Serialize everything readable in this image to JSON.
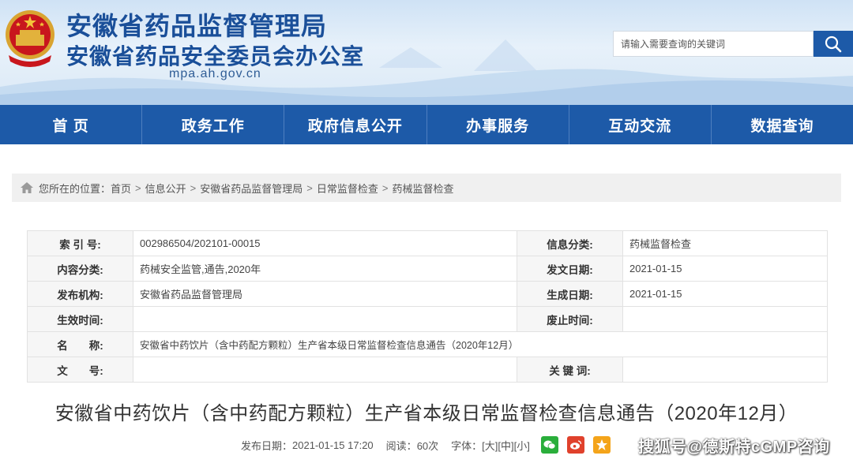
{
  "header": {
    "title_line1": "安徽省药品监督管理局",
    "title_line2": "安徽省药品安全委员会办公室",
    "url": "mpa.ah.gov.cn",
    "emblem": "national-emblem",
    "colors": {
      "title": "#1a4f99",
      "nav_bg": "#1d5aa8"
    }
  },
  "search": {
    "placeholder": "请输入需要查询的关键词",
    "icon": "search-icon"
  },
  "nav": {
    "items": [
      "首 页",
      "政务工作",
      "政府信息公开",
      "办事服务",
      "互动交流",
      "数据查询"
    ]
  },
  "breadcrumb": {
    "prefix": "您所在的位置：",
    "items": [
      "首页",
      "信息公开",
      "安徽省药品监督管理局",
      "日常监督检查",
      "药械监督检查"
    ],
    "separator": ">"
  },
  "info": {
    "index_label": "索 引 号:",
    "index_value": "002986504/202101-00015",
    "category_label": "信息分类:",
    "category_value": "药械监督检查",
    "content_type_label": "内容分类:",
    "content_type_value": "药械安全监管,通告,2020年",
    "issue_date_label": "发文日期:",
    "issue_date_value": "2021-01-15",
    "publisher_label": "发布机构:",
    "publisher_value": "安徽省药品监督管理局",
    "created_date_label": "生成日期:",
    "created_date_value": "2021-01-15",
    "effective_label": "生效时间:",
    "effective_value": "",
    "abolish_label": "废止时间:",
    "abolish_value": "",
    "name_label": "名　　称:",
    "name_value": "安徽省中药饮片（含中药配方颗粒）生产省本级日常监督检查信息通告（2020年12月）",
    "doc_no_label": "文　　号:",
    "doc_no_value": "",
    "keywords_label": "关 键 词:",
    "keywords_value": ""
  },
  "article": {
    "title": "安徽省中药饮片（含中药配方颗粒）生产省本级日常监督检查信息通告（2020年12月）",
    "publish_label": "发布日期：",
    "publish_value": "2021-01-15 17:20",
    "reads_label": "阅读：",
    "reads_value": "60次",
    "font_label": "字体：",
    "font_large": "[大]",
    "font_medium": "[中]",
    "font_small": "[小]"
  },
  "share": {
    "icons": [
      "wechat-icon",
      "weibo-icon",
      "qzone-icon"
    ],
    "colors": {
      "wechat": "#2aae3b",
      "weibo": "#e0412c",
      "qzone": "#f4a41a"
    }
  },
  "watermark": "搜狐号@德斯特cGMP咨询"
}
